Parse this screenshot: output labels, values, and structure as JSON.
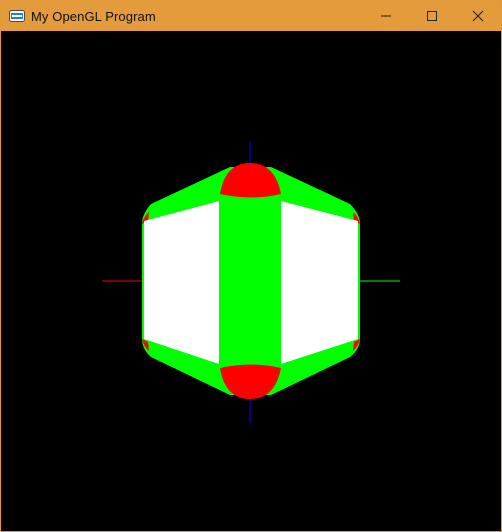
{
  "window": {
    "title": "My OpenGL Program",
    "icons": {
      "app": "opengl-app-icon",
      "minimize": "minimize-icon",
      "maximize": "maximize-icon",
      "close": "close-icon"
    },
    "colors": {
      "titlebar": "#e39b3b",
      "background": "#000000"
    }
  },
  "scene": {
    "colors": {
      "white_face": "#ffffff",
      "green": "#00ff00",
      "red": "#ff0000",
      "blue_axis": "#0000ff",
      "red_axis": "#ff0000",
      "green_axis": "#00ff00"
    }
  }
}
